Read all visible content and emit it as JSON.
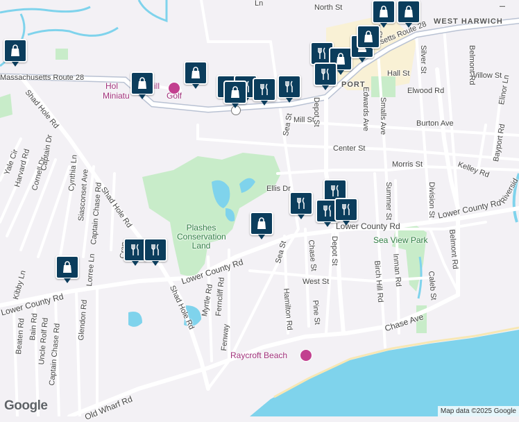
{
  "map": {
    "streets": {
      "north_st": "North St",
      "west_harwich": "WEST HARWICH",
      "mass_route_28_east": "Massachusetts Route 28",
      "mass_route_28_west": "Massachusetts Route 28",
      "hall_st": "Hall St",
      "willow_st": "Willow St",
      "elwood_rd": "Elwood Rd",
      "silver_st": "Silver St",
      "belmont_rd": "Belmont Rd",
      "shad_hole_rd_1": "Shad Hole Rd",
      "shad_hole_rd_2": "Shad Hole Rd",
      "shad_hole_rd_3": "Shad Hole Rd",
      "mill_st": "Mill St",
      "sea_st_1": "Sea St",
      "sea_st_2": "Sea St",
      "depot_st_1": "Depot St",
      "depot_st_2": "Depot St",
      "edwards_ave": "Edwards Ave",
      "smalls_ave": "Smalls Ave",
      "burton_ave": "Burton Ave",
      "elinor_ln": "Elinor Ln",
      "center_st": "Center St",
      "bayport_rd": "Bayport Rd",
      "kelley_rd": "Kelley Rd",
      "morris_st": "Morris St",
      "ellis_dr": "Ellis Dr",
      "summer_st": "Summer St",
      "division_st": "Division St",
      "lower_county_rd_1": "Lower County Rd",
      "lower_county_rd_2": "Lower County Rd",
      "lower_county_rd_3": "Lower County Rd",
      "lower_county_rd_4": "Lower County Rd",
      "riverside": "Riversid",
      "yale_cir": "Yale Cir",
      "harvard_rd": "Harvard Rd",
      "cornell_dr": "Cornell Dr",
      "captain_dr": "Captain Dr",
      "cynthia_ln": "Cynthia Ln",
      "siasconset_ave": "Siasconset Ave",
      "captain_chase_rd_1": "Captain Chase Rd",
      "captain_chase_rd_2": "Captain Chase Rd",
      "lorree_ln": "Lorree Ln",
      "kibby_ln": "Kibby Ln",
      "beaten_rd": "Beaten Rd",
      "bain_rd": "Bain Rd",
      "uncle_rolf_rd": "Uncle Rolf Rd",
      "glendon_rd": "Glendon Rd",
      "myrtle_rd": "Myrtle Rd",
      "ferncliff_rd": "Ferncliff Rd",
      "fenway": "Fenway",
      "hamilton_rd": "Hamilton Rd",
      "chase_st": "Chase St",
      "pine_st": "Pine St",
      "west_st": "West St",
      "birch_hill_rd": "Birch Hill Rd",
      "inman_rd": "Inman Rd",
      "caleb_st": "Caleb St",
      "chase_ave": "Chase Ave",
      "old_wharf_rd": "Old Wharf Rd",
      "port_fragment": "PORT",
      "n_fragment": "n St",
      "ln_fragment": "Ln",
      "cran_fragment": "Cran",
      "l_fragment": "l"
    },
    "parks": {
      "plashes": "Plashes Conservation Land",
      "sea_view": "Sea View Park"
    },
    "pois": {
      "raycroft_beach": "Raycroft Beach",
      "mini_golf_a": "Hol",
      "mini_golf_b": "ill",
      "mini_golf_c": "Miniatu",
      "mini_golf_d": "Golf"
    },
    "attribution": "Map data ©2025 Google",
    "logo": "Google",
    "colors": {
      "land": "#f3f1f5",
      "water": "#7fd3ec",
      "park": "#c8ecc9",
      "road": "#ffffff",
      "major_road": "#b9c2d3",
      "marker": "#0b3d5c",
      "highlight": "#fbf1c7"
    },
    "marker_icons": [
      "shopping-bag-icon",
      "fork-knife-icon"
    ]
  }
}
